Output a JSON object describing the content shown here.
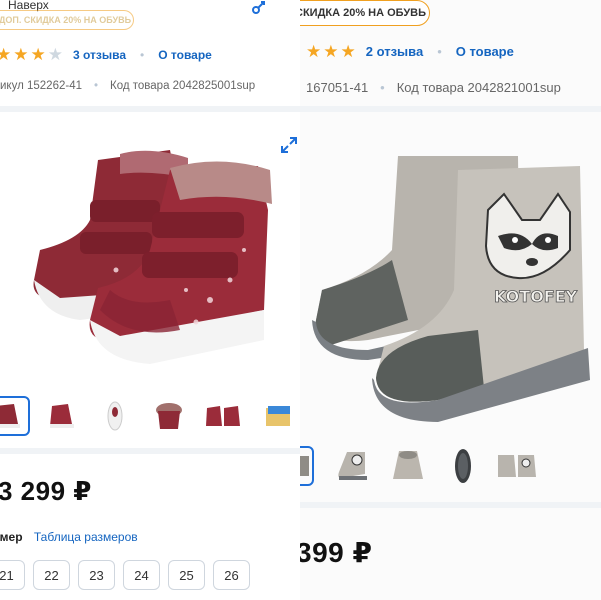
{
  "left": {
    "back_label": "Наверх",
    "promo": "ДОП. СКИДКА 20% НА ОБУВЬ",
    "rating": {
      "stars": 3,
      "max": 4,
      "reviews": "3 отзыва",
      "about": "О товаре"
    },
    "article": "икул 152262-41",
    "product_code": "Код товара 2042825001sup",
    "price": "3 299 ₽",
    "sizes_label": "змер",
    "size_table_link": "Таблица размеров",
    "sizes": [
      "21",
      "22",
      "23",
      "24",
      "25",
      "26"
    ]
  },
  "right": {
    "promo": "СКИДКА 20% НА ОБУВЬ",
    "rating": {
      "stars": 3,
      "reviews": "2 отзыва",
      "about": "О товаре"
    },
    "article": "167051-41",
    "product_code": "Код товара 2042821001sup",
    "price": "399 ₽",
    "boot_print": "KOTOFEY"
  },
  "colors": {
    "accent": "#1e6fd9",
    "link": "#1565c0",
    "star": "#f5a623",
    "promo_border": "#f0a020"
  }
}
